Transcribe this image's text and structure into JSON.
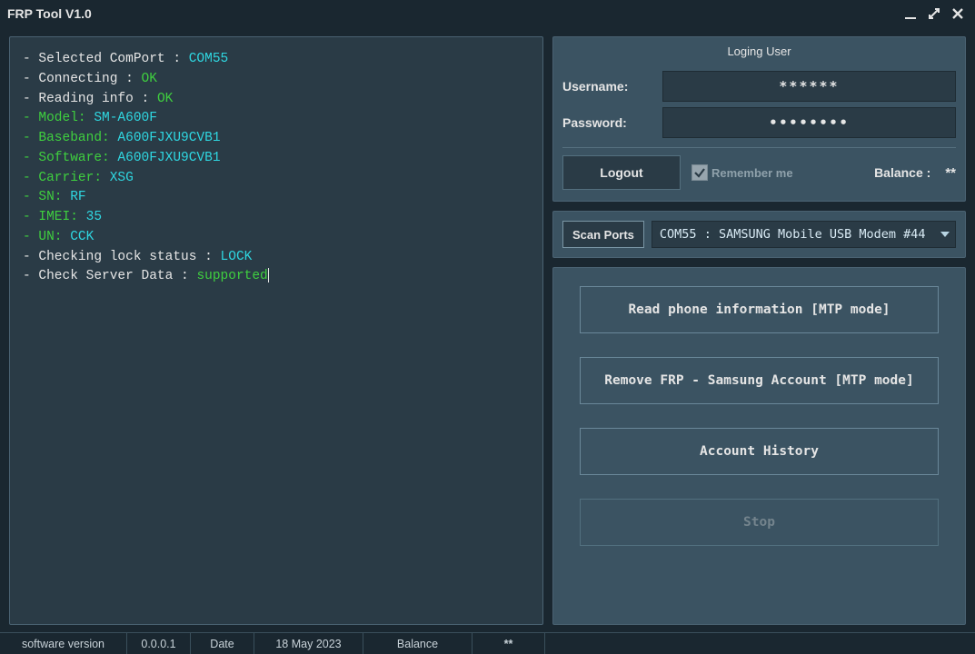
{
  "app": {
    "title": "FRP Tool V1.0"
  },
  "log": {
    "lines": [
      {
        "parts": [
          [
            "- Selected ComPort : ",
            "white"
          ],
          [
            "COM55",
            "cyan"
          ]
        ]
      },
      {
        "parts": [
          [
            "- Connecting : ",
            "white"
          ],
          [
            "OK",
            "green"
          ]
        ]
      },
      {
        "parts": [
          [
            "- Reading info : ",
            "white"
          ],
          [
            "OK",
            "green"
          ]
        ]
      },
      {
        "parts": [
          [
            "- Model: ",
            "green"
          ],
          [
            "SM-A600F",
            "cyan"
          ]
        ]
      },
      {
        "parts": [
          [
            "- Baseband: ",
            "green"
          ],
          [
            "A600FJXU9CVB1",
            "cyan"
          ]
        ]
      },
      {
        "parts": [
          [
            "- Software: ",
            "green"
          ],
          [
            "A600FJXU9CVB1",
            "cyan"
          ]
        ]
      },
      {
        "parts": [
          [
            "- Carrier: ",
            "green"
          ],
          [
            "XSG",
            "cyan"
          ]
        ]
      },
      {
        "parts": [
          [
            "- SN: ",
            "green"
          ],
          [
            "RF",
            "cyan"
          ]
        ]
      },
      {
        "parts": [
          [
            "- IMEI: ",
            "green"
          ],
          [
            "35",
            "cyan"
          ]
        ]
      },
      {
        "parts": [
          [
            "- UN: ",
            "green"
          ],
          [
            "CCK",
            "cyan"
          ]
        ]
      },
      {
        "parts": [
          [
            "- Checking lock status : ",
            "white"
          ],
          [
            "LOCK",
            "cyan"
          ]
        ]
      },
      {
        "parts": [
          [
            "- Check Server Data : ",
            "white"
          ],
          [
            "supported",
            "green"
          ]
        ]
      }
    ]
  },
  "login": {
    "heading": "Loging User",
    "username_label": "Username:",
    "password_label": "Password:",
    "username_value": "******",
    "password_value": "••••••••",
    "logout_label": "Logout",
    "remember_label": "Remember me",
    "remember_checked": true,
    "balance_label": "Balance : ",
    "balance_value": "**"
  },
  "ports": {
    "scan_label": "Scan Ports",
    "selected": "COM55 : SAMSUNG Mobile USB Modem #44"
  },
  "actions": {
    "read_info": "Read phone information [MTP mode]",
    "remove_frp": "Remove FRP - Samsung Account [MTP mode]",
    "account_history": "Account History",
    "stop": "Stop"
  },
  "statusbar": {
    "sw_label": "software version",
    "sw_value": "0.0.0.1",
    "date_label": "Date",
    "date_value": "18 May 2023",
    "balance_label": "Balance",
    "balance_value": "**"
  }
}
